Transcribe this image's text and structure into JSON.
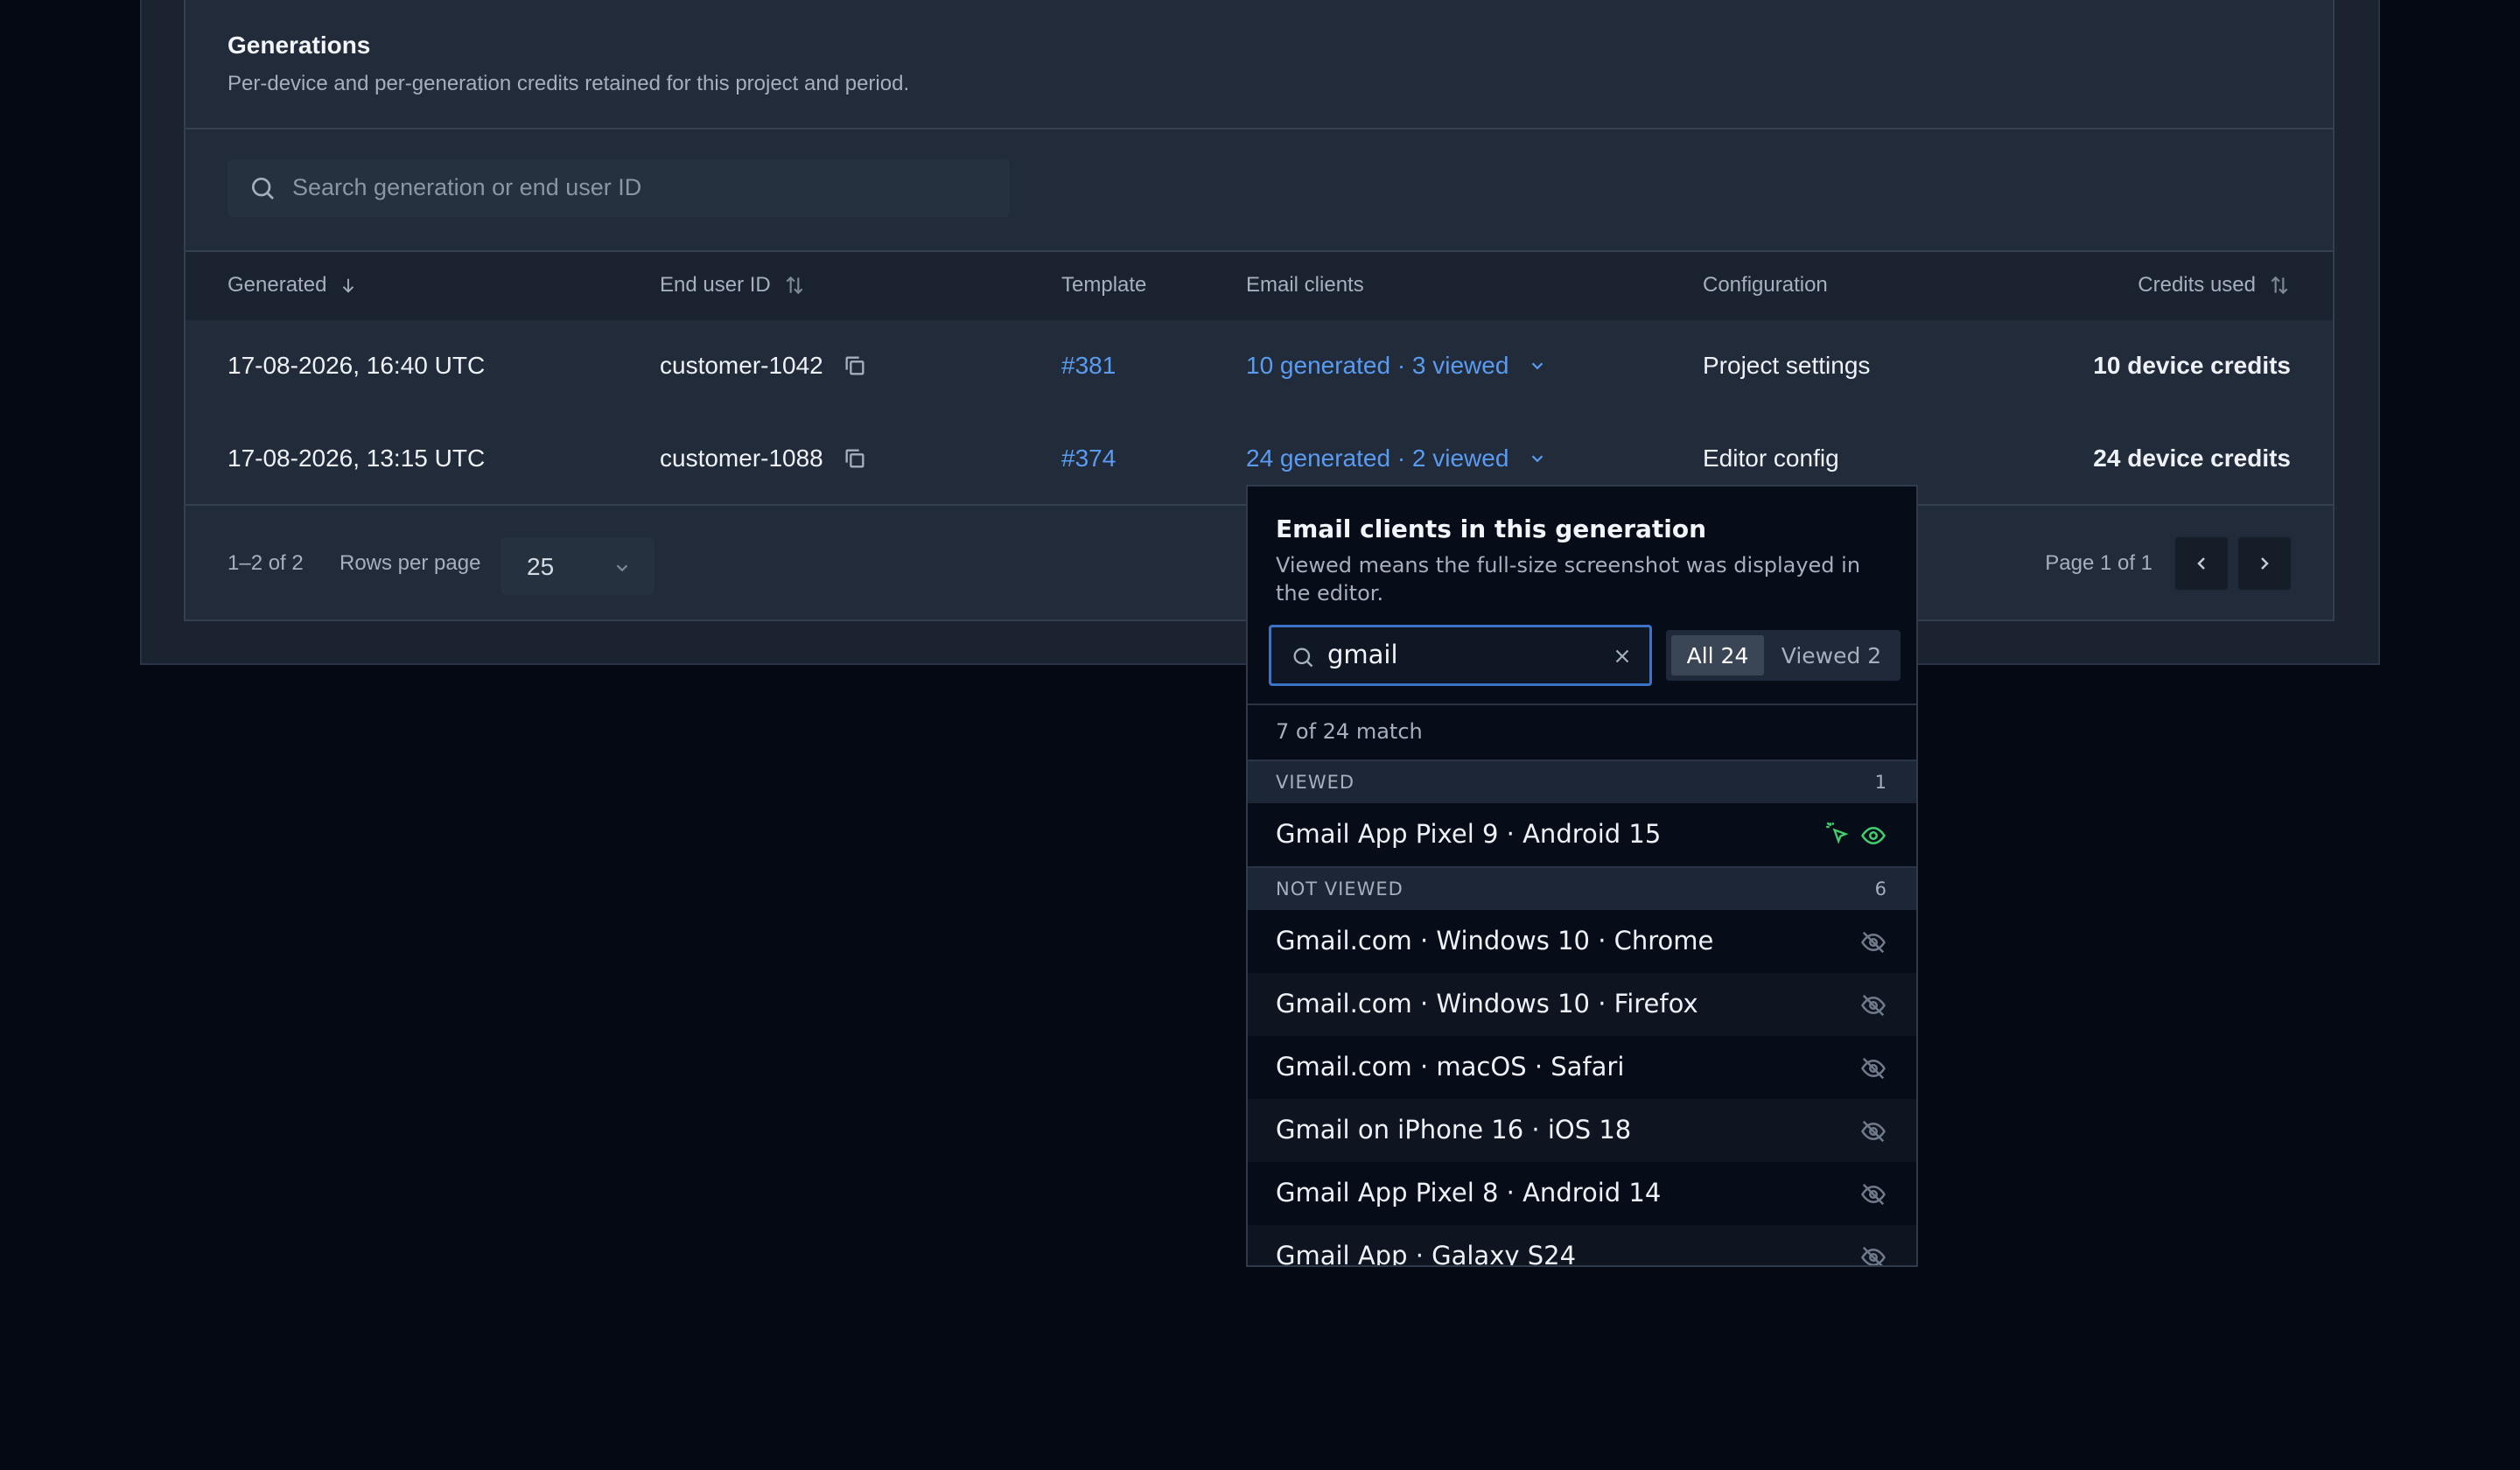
{
  "card": {
    "title": "Generations",
    "subtitle": "Per-device and per-generation credits retained for this project and period.",
    "search_placeholder": "Search generation or end user ID"
  },
  "table": {
    "columns": {
      "generated": "Generated",
      "end_user": "End user ID",
      "template": "Template",
      "email_clients": "Email clients",
      "configuration": "Configuration",
      "credits": "Credits used"
    },
    "rows": [
      {
        "generated": "17-08-2026, 16:40 UTC",
        "end_user": "customer-1042",
        "template": "#381",
        "clients": "10 generated · 3 viewed",
        "configuration": "Project settings",
        "credits": "10 device credits"
      },
      {
        "generated": "17-08-2026, 13:15 UTC",
        "end_user": "customer-1088",
        "template": "#374",
        "clients": "24 generated · 2 viewed",
        "configuration": "Editor config",
        "credits": "24 device credits"
      }
    ]
  },
  "footer": {
    "range": "1–2 of 2",
    "rows_per_page_label": "Rows per page",
    "rows_per_page_value": "25",
    "page": "Page 1 of 1"
  },
  "popover": {
    "title": "Email clients in this generation",
    "subtitle": "Viewed means the full-size screenshot was displayed in the editor.",
    "search_value": "gmail",
    "filter_all": "All 24",
    "filter_viewed": "Viewed 2",
    "match_text": "7 of 24 match",
    "viewed_group": {
      "label": "VIEWED",
      "count": "1",
      "items": [
        "Gmail App Pixel 9 · Android 15"
      ]
    },
    "not_viewed_group": {
      "label": "NOT VIEWED",
      "count": "6",
      "items": [
        "Gmail.com · Windows 10 · Chrome",
        "Gmail.com · Windows 10 · Firefox",
        "Gmail.com · macOS · Safari",
        "Gmail on iPhone 16 · iOS 18",
        "Gmail App Pixel 8 · Android 14",
        "Gmail App · Galaxy S24"
      ]
    }
  },
  "colors": {
    "accent": "#5a9bf0",
    "viewed": "#3fcf6f",
    "focus": "#3d73c7"
  }
}
